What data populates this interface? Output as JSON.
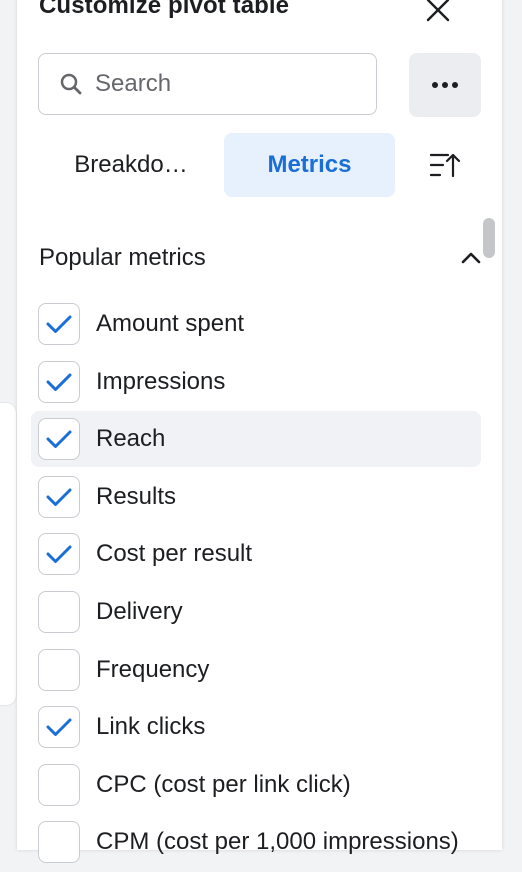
{
  "panel": {
    "title": "Customize pivot table"
  },
  "search": {
    "placeholder": "Search"
  },
  "tabs": [
    {
      "label": "Breakdo…",
      "active": false
    },
    {
      "label": "Metrics",
      "active": true
    }
  ],
  "section": {
    "title": "Popular metrics",
    "expanded": true
  },
  "metrics": [
    {
      "label": "Amount spent",
      "checked": true
    },
    {
      "label": "Impressions",
      "checked": true
    },
    {
      "label": "Reach",
      "checked": true,
      "hovered": true
    },
    {
      "label": "Results",
      "checked": true
    },
    {
      "label": "Cost per result",
      "checked": true
    },
    {
      "label": "Delivery",
      "checked": false
    },
    {
      "label": "Frequency",
      "checked": false
    },
    {
      "label": "Link clicks",
      "checked": true
    },
    {
      "label": "CPC (cost per link click)",
      "checked": false
    },
    {
      "label": "CPM (cost per 1,000 impressions)",
      "checked": false
    }
  ],
  "icons": {
    "close": "close-icon",
    "search": "search-icon",
    "more": "more-horizontal-icon",
    "sort": "sort-icon",
    "collapse": "chevron-up-icon",
    "check": "check-icon"
  },
  "colors": {
    "accent": "#1a6ed8",
    "active_tab_bg": "#e7f0fd",
    "check": "#1a6ed8"
  }
}
